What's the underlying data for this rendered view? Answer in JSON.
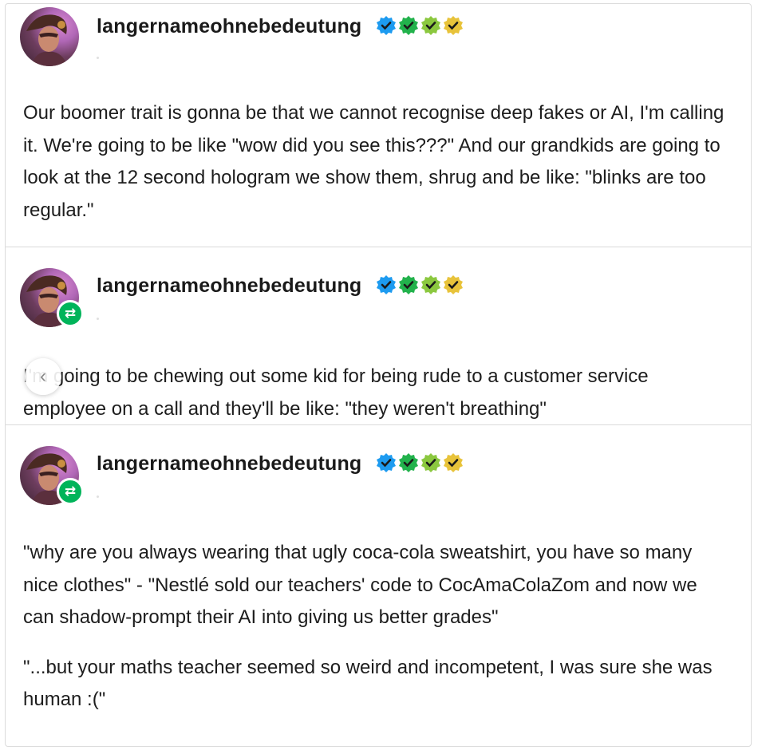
{
  "posts": [
    {
      "username": "langernameohnebedeutung",
      "is_reblog": false,
      "paragraphs": [
        "Our boomer trait is gonna be that we cannot recognise deep fakes or AI, I'm calling it. We're going to be like \"wow did you see this???\" And our grandkids are going to look at the 12 second hologram we show them, shrug and be like: \"blinks are too regular.\""
      ]
    },
    {
      "username": "langernameohnebedeutung",
      "is_reblog": true,
      "paragraphs": [
        "I'm going to be chewing out some kid for being rude to a customer service employee on a call and they'll be like: \"they weren't breathing\""
      ]
    },
    {
      "username": "langernameohnebedeutung",
      "is_reblog": true,
      "paragraphs": [
        "\"why are you always wearing that ugly coca-cola sweatshirt, you have so many nice clothes\" - \"Nestlé sold our teachers' code to CocAmaColaZom and now we can shadow-prompt their AI into giving us better grades\"",
        "\"...but your maths teacher seemed so weird and incompetent, I was sure she was human :(\""
      ]
    }
  ],
  "icons": {
    "verified_badges": [
      "blue-check-icon",
      "green-check-icon",
      "lime-check-icon",
      "yellow-check-icon"
    ],
    "reblog": "reblog-icon",
    "scroll_left": "chevron-left-icon"
  },
  "colors": {
    "badge_blue": "#1d9bf0",
    "badge_green": "#22b24c",
    "badge_lime": "#8bc83f",
    "badge_yellow": "#e8c33a",
    "reblog_green": "#00b45a"
  }
}
